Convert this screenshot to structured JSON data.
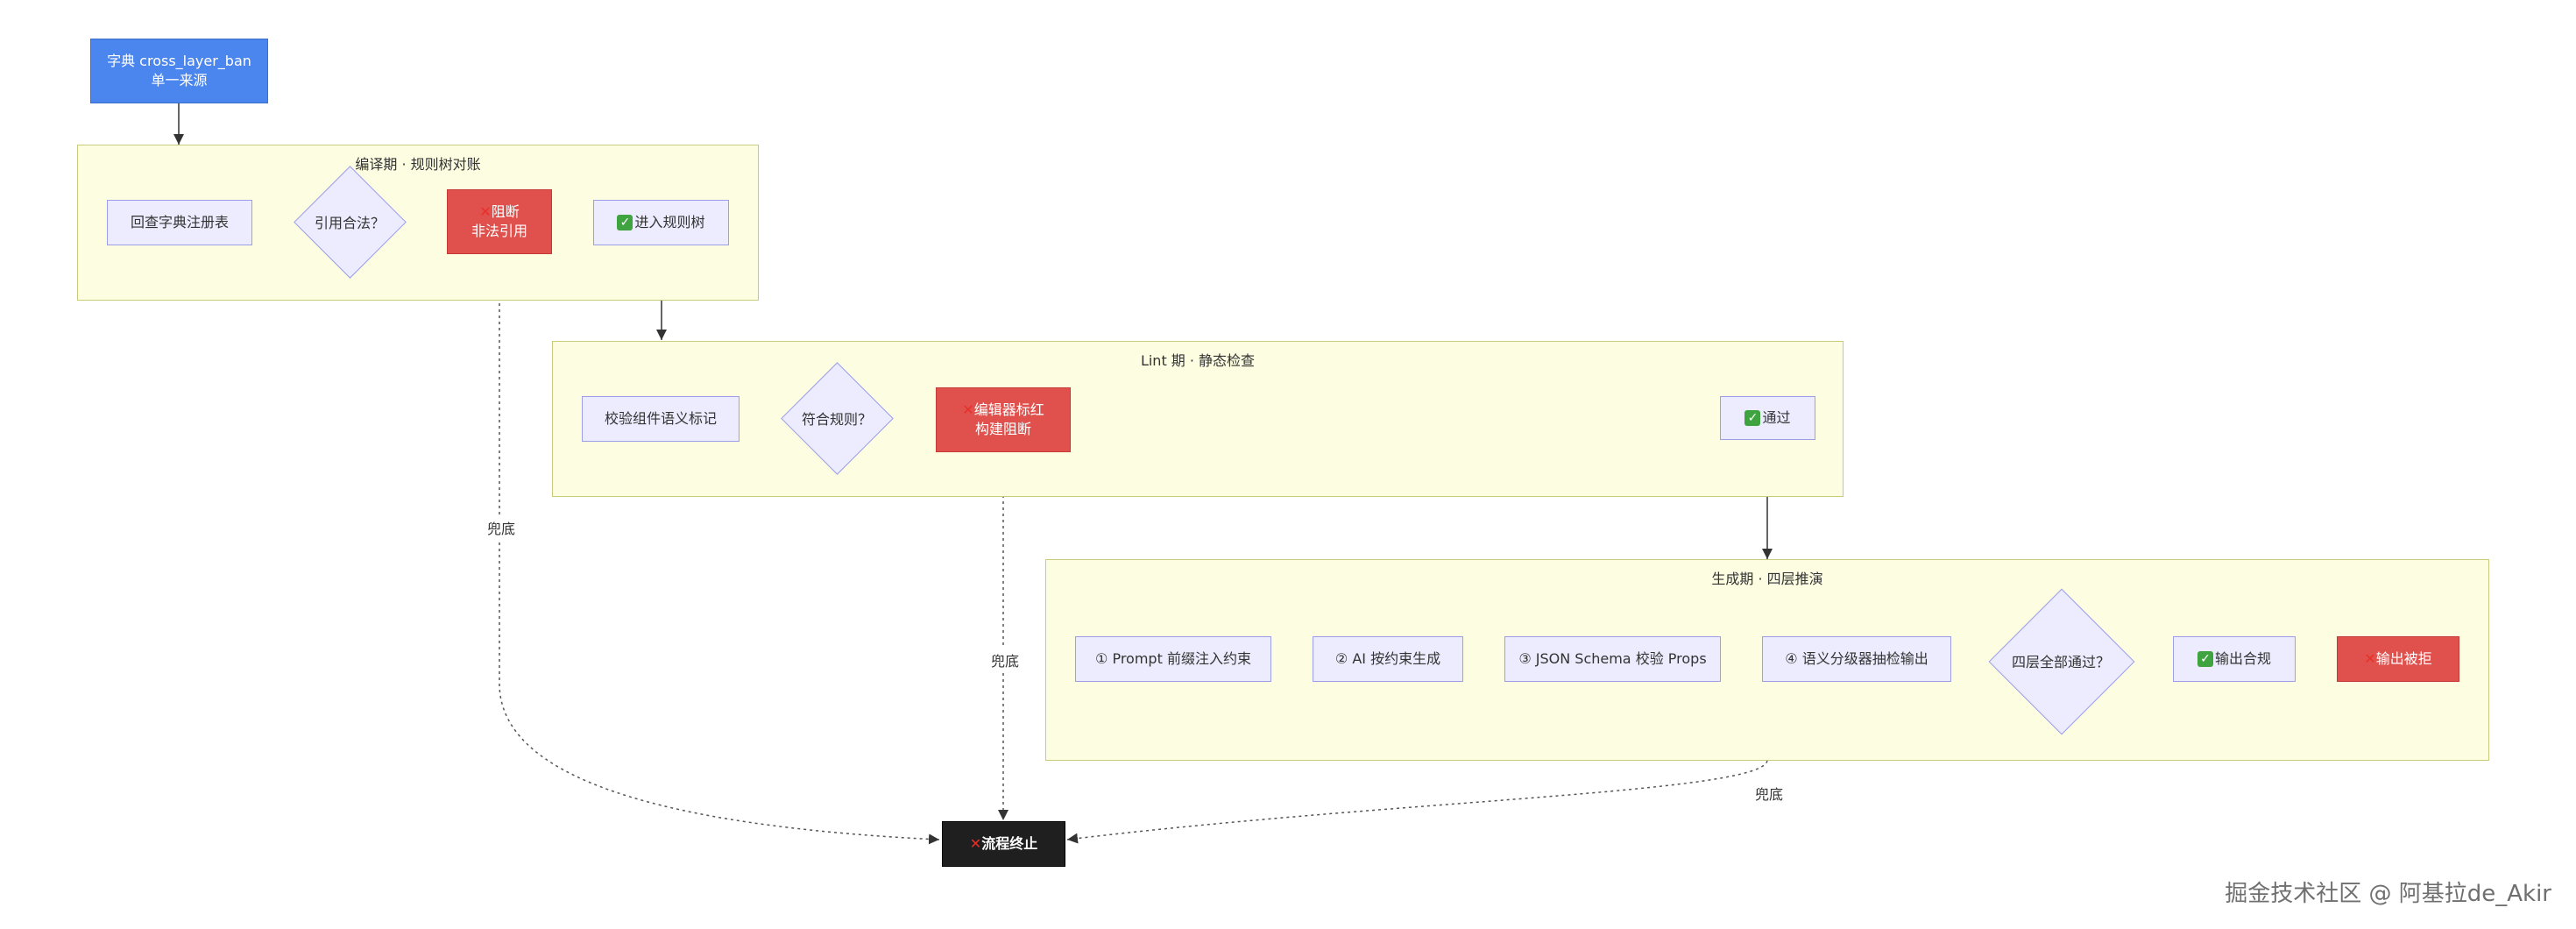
{
  "start_node": {
    "line1": "字典 cross_layer_ban",
    "line2": "单一来源"
  },
  "clusters": {
    "compile": {
      "title": "编译期 · 规则树对账"
    },
    "lint": {
      "title": "Lint 期 · 静态检查"
    },
    "generate": {
      "title": "生成期 · 四层推演"
    }
  },
  "compile_nodes": {
    "lookup": "回查字典注册表",
    "decision": "引用合法？",
    "block_line1": "阻断",
    "block_line2": "非法引用",
    "enter": "进入规则树"
  },
  "lint_nodes": {
    "check": "校验组件语义标记",
    "decision": "符合规则？",
    "block_line1": "编辑器标红",
    "block_line2": "构建阻断",
    "pass": "通过"
  },
  "generate_nodes": {
    "step1": "① Prompt 前缀注入约束",
    "step2": "② AI 按约束生成",
    "step3": "③ JSON Schema 校验 Props",
    "step4": "④ 语义分级器抽检输出",
    "decision": "四层全部通过？",
    "ok": "输出合规",
    "rejected": "输出被拒"
  },
  "terminal": "流程终止",
  "edge_labels": {
    "fallback": "兜底"
  },
  "icons": {
    "cross": "cross-mark-icon",
    "check": "check-mark-icon"
  },
  "colors": {
    "start": "#4b86ee",
    "reject": "#e0504c",
    "terminal": "#1f1f1f",
    "cluster": "#fdfde1",
    "node": "#ececfe"
  },
  "watermark": "掘金技术社区 @ 阿基拉de_Akir"
}
